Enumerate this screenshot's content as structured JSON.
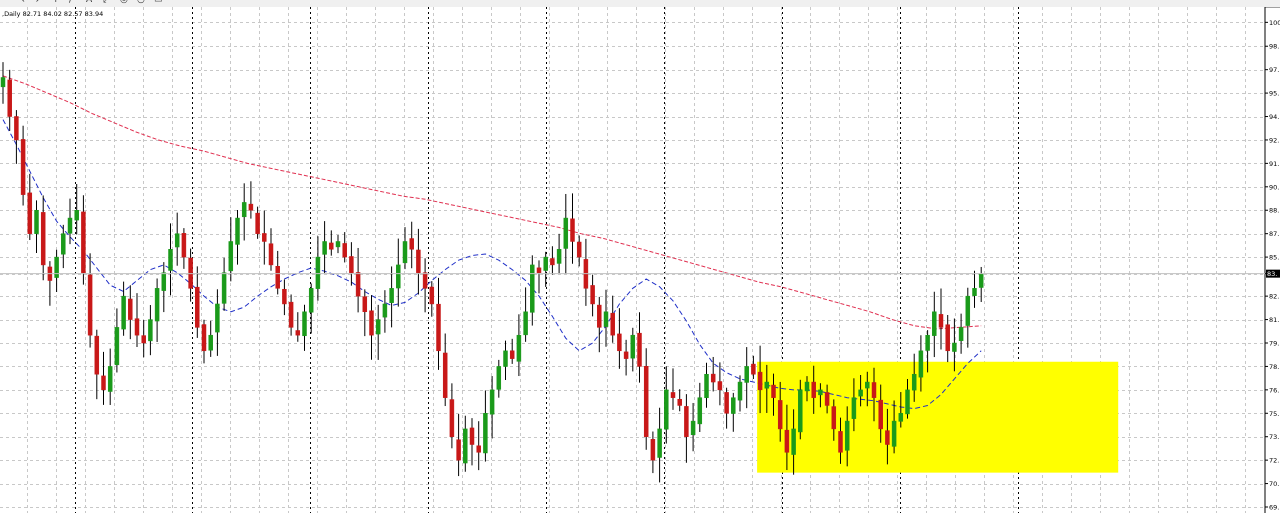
{
  "window": {
    "symbol_line": ",Daily  82.71 84.02 82.57 83.94",
    "toolbar_icons": [
      "arrow-icon",
      "cursor-icon",
      "crosshair-icon",
      "line-icon",
      "text-icon",
      "arrow-cross-icon",
      "zoom-icon",
      "period-icon",
      "template-icon"
    ]
  },
  "chart_data": {
    "type": "candlestick",
    "timeframe": "Daily",
    "ohlc_header": {
      "open": 82.71,
      "high": 84.02,
      "low": 82.57,
      "close": 83.94
    },
    "current_price_label": "83.",
    "y_tick_labels": [
      "100.",
      "98.",
      "97.",
      "95.",
      "94.",
      "92.",
      "91.",
      "90.",
      "88.",
      "87.",
      "85.",
      "84.",
      "82.",
      "81.",
      "79.",
      "78.",
      "76.",
      "75.",
      "73.",
      "72.",
      "70.",
      "69."
    ],
    "y_tick_values": [
      100.03,
      98.5,
      97.0,
      95.5,
      94.0,
      92.5,
      91.0,
      89.5,
      88.0,
      86.5,
      85.0,
      83.94,
      82.5,
      81.0,
      79.5,
      78.0,
      76.5,
      75.0,
      73.5,
      72.0,
      70.5,
      69.0
    ],
    "ylim": [
      69.0,
      100.5
    ],
    "grid": true,
    "colors": {
      "up": "#1a9a1a",
      "down": "#c81818",
      "ma_fast": "#2030c8",
      "ma_slow": "#e03050",
      "highlight": "#ffff00",
      "grid": "#c8c8c8"
    },
    "highlight_box": {
      "from_index": 113,
      "to_index": 166,
      "y_low": 71.2,
      "y_high": 78.3
    },
    "close_path": [
      96.5,
      94.0,
      92.5,
      89.0,
      86.5,
      88.0,
      84.5,
      83.5,
      85.0,
      86.5,
      87.5,
      88.0,
      84.0,
      80.0,
      77.5,
      76.5,
      78.0,
      80.5,
      82.5,
      81.0,
      80.0,
      79.5,
      81.0,
      83.0,
      84.0,
      85.5,
      86.5,
      85.0,
      83.0,
      80.5,
      79.0,
      80.0,
      82.0,
      84.0,
      86.0,
      87.5,
      88.5,
      88.0,
      86.5,
      86.0,
      84.5,
      83.0,
      82.0,
      80.5,
      80.0,
      81.5,
      83.0,
      85.0,
      86.0,
      85.5,
      86.0,
      85.0,
      84.0,
      82.5,
      81.5,
      80.0,
      81.0,
      82.0,
      83.0,
      84.5,
      86.0,
      85.5,
      84.0,
      83.0,
      82.0,
      79.0,
      76.0,
      73.5,
      72.0,
      74.0,
      73.0,
      72.5,
      75.0,
      76.5,
      78.0,
      79.0,
      78.5,
      80.0,
      81.5,
      84.5,
      84.0,
      85.0,
      84.5,
      85.5,
      87.5,
      86.0,
      85.0,
      83.0,
      82.0,
      80.5,
      81.5,
      80.0,
      79.0,
      78.5,
      80.0,
      78.0,
      73.5,
      72.0,
      74.0,
      76.5,
      76.0,
      75.5,
      73.5,
      74.5,
      76.0,
      77.5,
      77.0,
      76.5,
      75.0,
      76.0,
      77.0,
      78.0,
      77.5,
      76.5,
      77.0,
      76.0,
      74.0,
      72.5,
      74.0,
      76.5,
      77.0,
      76.0,
      76.5,
      75.5,
      74.0,
      72.5,
      74.5,
      76.0,
      76.5,
      77.0,
      76.0,
      74.0,
      73.0,
      74.5,
      75.0,
      76.5,
      77.5,
      79.0,
      80.0,
      81.5,
      80.5,
      79.0,
      79.5,
      80.5,
      82.5,
      83.0,
      83.94
    ],
    "ma_fast_path": [
      93.8,
      92.2,
      90.5,
      88.8,
      87.3,
      86.3,
      85.4,
      84.3,
      83.2,
      82.8,
      83.5,
      84.2,
      84.5,
      84.0,
      83.3,
      82.5,
      81.8,
      81.5,
      81.8,
      82.5,
      83.1,
      83.6,
      84.0,
      84.3,
      84.1,
      83.8,
      83.4,
      82.8,
      82.3,
      81.9,
      82.1,
      82.7,
      83.5,
      84.2,
      84.8,
      85.1,
      85.2,
      84.8,
      84.2,
      83.5,
      82.5,
      81.2,
      79.8,
      79.0,
      79.5,
      80.6,
      82.0,
      83.0,
      83.6,
      83.1,
      82.2,
      80.9,
      79.4,
      78.2,
      77.6,
      77.2,
      77.0,
      76.8,
      76.6,
      76.5,
      76.5,
      76.4,
      76.2,
      76.0,
      75.9,
      75.8,
      75.6,
      75.4,
      75.3,
      75.5,
      76.2,
      77.2,
      78.2,
      79.0
    ],
    "ma_slow_path": [
      96.6,
      96.1,
      95.5,
      94.9,
      94.2,
      93.6,
      93.0,
      92.5,
      92.1,
      91.8,
      91.4,
      91.0,
      90.7,
      90.4,
      90.1,
      89.8,
      89.5,
      89.2,
      88.9,
      88.7,
      88.4,
      88.1,
      87.8,
      87.5,
      87.2,
      86.9,
      86.5,
      86.2,
      85.8,
      85.4,
      85.0,
      84.6,
      84.2,
      83.8,
      83.4,
      83.1,
      82.7,
      82.3,
      81.9,
      81.5,
      81.0,
      80.6,
      80.4,
      80.5,
      80.6
    ]
  }
}
